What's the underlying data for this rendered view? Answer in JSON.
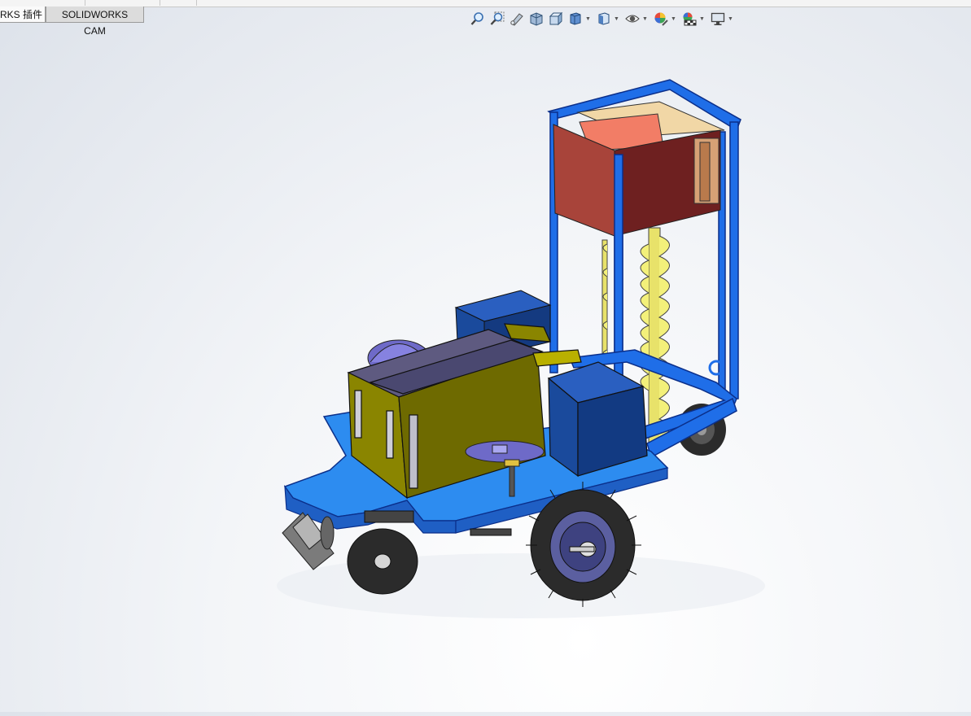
{
  "tabs": [
    {
      "label": "RKS 插件"
    },
    {
      "label": "SOLIDWORKS CAM"
    }
  ],
  "heads_up_toolbar": [
    {
      "icon": "zoom-to-fit-icon"
    },
    {
      "icon": "zoom-to-area-icon"
    },
    {
      "icon": "previous-view-icon"
    },
    {
      "icon": "section-view-icon"
    },
    {
      "icon": "dynamic-annotation-icon"
    },
    {
      "icon": "view-orientation-icon",
      "has_dropdown": true
    },
    {
      "icon": "display-style-icon",
      "has_dropdown": true
    },
    {
      "icon": "hide-show-items-icon",
      "has_dropdown": true
    },
    {
      "icon": "edit-appearance-icon",
      "has_dropdown": true
    },
    {
      "icon": "apply-scene-icon",
      "has_dropdown": true
    },
    {
      "icon": "view-settings-icon",
      "has_dropdown": true
    }
  ],
  "colors": {
    "frame_blue": "#1f6ee8",
    "chassis_blue": "#2d8cf0",
    "hopper_navy": "#1a4a9c",
    "seed_box_olive": "#8a8500",
    "auger_yellow": "#f3f07a",
    "upper_box_red": "#b24a3a",
    "tire_dark": "#2b2b2b"
  }
}
